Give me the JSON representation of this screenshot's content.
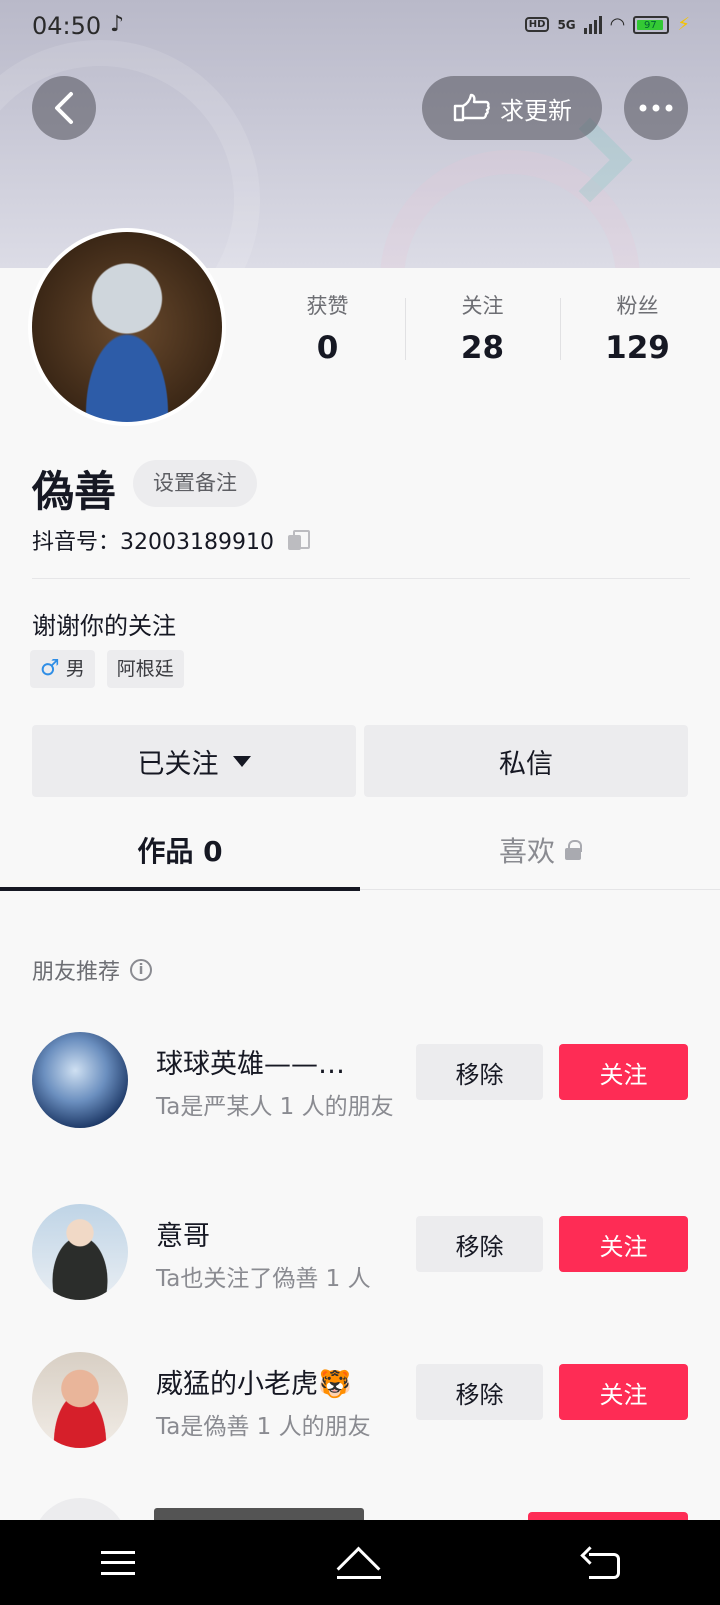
{
  "status_bar": {
    "time": "04:50",
    "network": "5G",
    "hd": "HD",
    "battery": "97"
  },
  "header": {
    "update_label": "求更新"
  },
  "profile": {
    "name": "偽善",
    "remark_label": "设置备注",
    "douyin_id": "抖音号：32003189910",
    "bio": "谢谢你的关注",
    "gender_icon": "♂",
    "gender": "男",
    "region": "阿根廷"
  },
  "stats": [
    {
      "label": "获赞",
      "value": "0"
    },
    {
      "label": "关注",
      "value": "28"
    },
    {
      "label": "粉丝",
      "value": "129"
    }
  ],
  "actions": {
    "followed_label": "已关注",
    "message_label": "私信"
  },
  "tabs": [
    {
      "label": "作品 0"
    },
    {
      "label": "喜欢"
    }
  ],
  "recommend": {
    "title": "朋友推荐",
    "items": [
      {
        "name": "球球英雄——…",
        "desc": "Ta是严某人 1 人的朋友",
        "remove": "移除",
        "follow": "关注"
      },
      {
        "name": "意哥",
        "desc": "Ta也关注了偽善 1 人",
        "remove": "移除",
        "follow": "关注"
      },
      {
        "name": "威猛的小老虎🐯",
        "desc": "Ta是偽善 1 人的朋友",
        "remove": "移除",
        "follow": "关注"
      }
    ]
  },
  "colors": {
    "accent": "#fe2c55",
    "text": "#161823",
    "muted": "#8a8b91"
  }
}
